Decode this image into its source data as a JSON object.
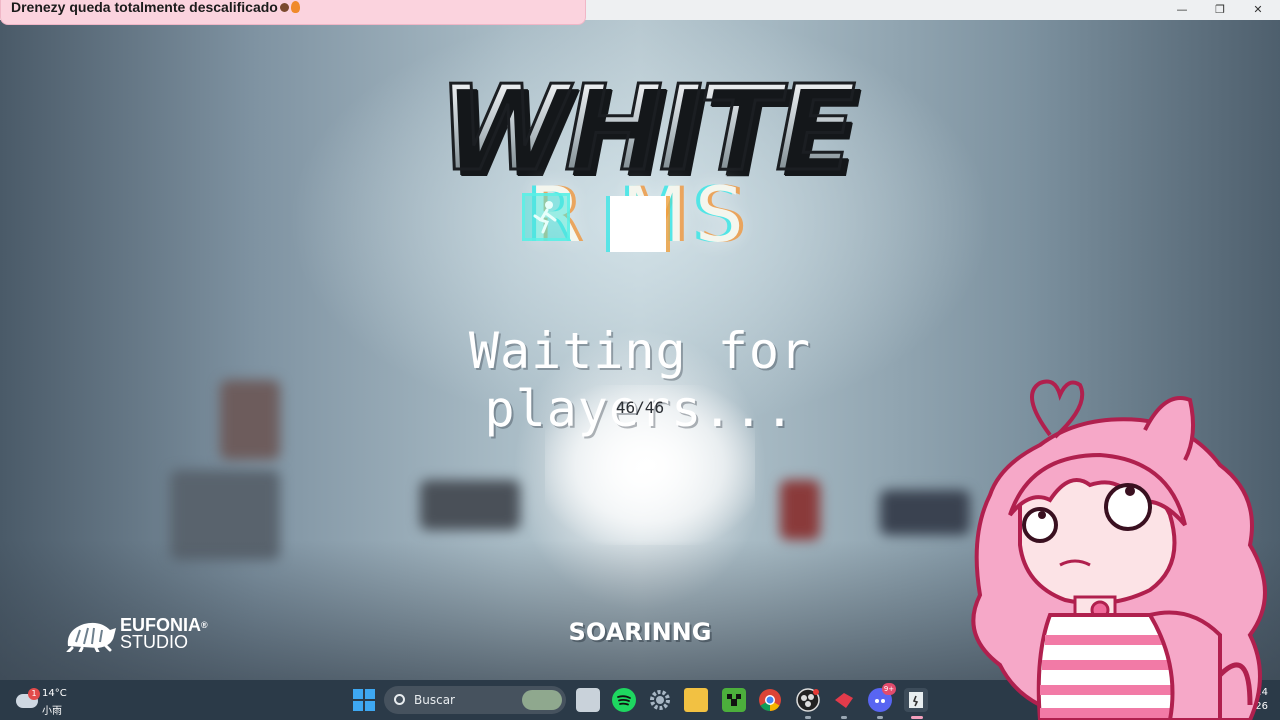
{
  "window": {
    "minimize": "—",
    "maximize": "❐",
    "close": "✕"
  },
  "notification": {
    "text": "Drenezy queda totalmente descalificado"
  },
  "game": {
    "logo_top": "WHITE",
    "logo_bottom": "R  MS",
    "status": "Waiting for players...",
    "player_count": "46/46",
    "player_name": "SOARINNG"
  },
  "studio": {
    "name_line1": "EUFONIA",
    "name_line2": "STUDIO",
    "registered": "®"
  },
  "taskbar": {
    "weather": {
      "badge": "1",
      "temperature": "14°C",
      "condition": "小雨"
    },
    "search_label": "Buscar",
    "clock": {
      "time": ":4",
      "date": "22-0  26"
    },
    "apps": [
      "file-explorer",
      "spotify",
      "settings",
      "folder",
      "minecraft",
      "chrome",
      "obs",
      "app-red",
      "discord",
      "white-rooms"
    ],
    "discord_badge": "9+"
  },
  "colors": {
    "notice_bg": "#fbd3de",
    "taskbar_bg": "#2b3a48",
    "accent_cyan": "#3ce6e6",
    "avatar_pink": "#f6a8c8"
  }
}
